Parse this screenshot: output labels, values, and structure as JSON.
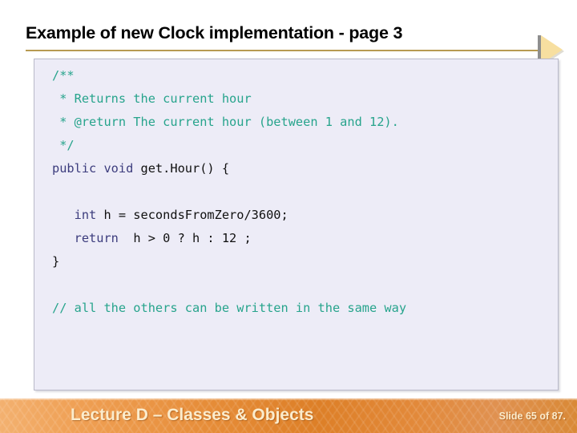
{
  "slide": {
    "title": "Example of new Clock implementation - page 3",
    "accent_rule_color": "#b79a52",
    "arrow_color": "#f7dfa0"
  },
  "code_box": {
    "background": "#edecf7",
    "border_color": "#b9b9c9",
    "comment_color": "#27a48c",
    "keyword_color": "#3c3c7d",
    "text_color": "#101010",
    "lines": [
      {
        "indent": 0,
        "segments": [
          {
            "text": "/**",
            "style": "cmt"
          }
        ]
      },
      {
        "indent": 0,
        "segments": [
          {
            "text": " * Returns the current hour",
            "style": "cmt"
          }
        ]
      },
      {
        "indent": 0,
        "segments": [
          {
            "text": " * @return The current hour (between 1 and 12).",
            "style": "cmt"
          }
        ]
      },
      {
        "indent": 0,
        "segments": [
          {
            "text": " */",
            "style": "cmt"
          }
        ]
      },
      {
        "indent": 0,
        "segments": [
          {
            "text": "public void ",
            "style": "kw"
          },
          {
            "text": "get.Hour() {",
            "style": "plain"
          }
        ]
      },
      {
        "indent": 0,
        "segments": [
          {
            "text": "",
            "style": "plain"
          }
        ]
      },
      {
        "indent": 0,
        "segments": [
          {
            "text": "   int ",
            "style": "kw"
          },
          {
            "text": "h = secondsFromZero/3600;",
            "style": "plain"
          }
        ]
      },
      {
        "indent": 0,
        "segments": [
          {
            "text": "   return ",
            "style": "kw"
          },
          {
            "text": " h > 0 ? h : 12 ;",
            "style": "plain"
          }
        ]
      },
      {
        "indent": 0,
        "segments": [
          {
            "text": "}",
            "style": "plain"
          }
        ]
      },
      {
        "indent": 0,
        "segments": [
          {
            "text": "",
            "style": "plain"
          }
        ]
      },
      {
        "indent": 0,
        "segments": [
          {
            "text": "// all the others can be written in the same way",
            "style": "cmt"
          }
        ]
      }
    ]
  },
  "footer": {
    "title": "Lecture D – Classes & Objects",
    "slide_number": "Slide 65 of 87.",
    "text_color": "#fbeccd"
  }
}
